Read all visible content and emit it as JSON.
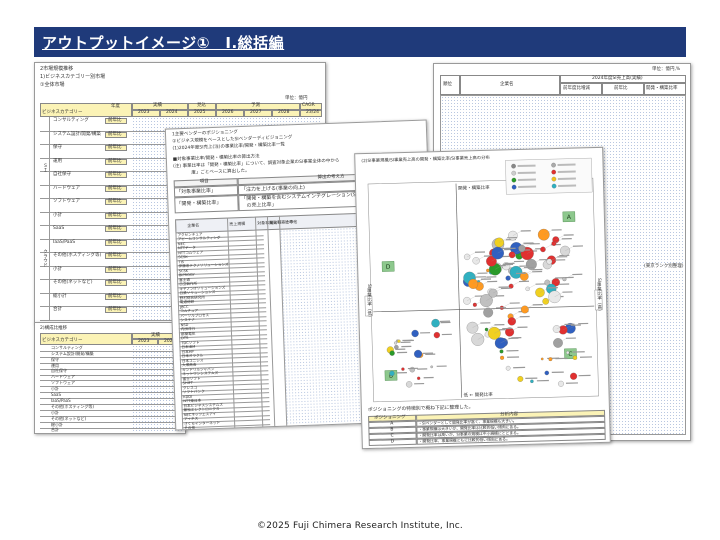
{
  "header": {
    "title": "アウトプットイメージ①　Ⅰ.総括編"
  },
  "sheet1": {
    "lines": [
      "2市場規模推移",
      "1)ビジネスカテゴリー別市場",
      "①全体市場"
    ],
    "unit": "単位：億円",
    "year_label": "年度",
    "category_label": "ビジネスカテゴリー",
    "cols": {
      "actual": "実績",
      "forecast_near": "見込",
      "forecast": "予測",
      "cagr": "CAGR"
    },
    "years": [
      "2023",
      "2024",
      "2025",
      "2026",
      "2027",
      "2028",
      "23/24"
    ],
    "rows": [
      "コンサルティング",
      "システム設計/開発/構築",
      "保守",
      "運用",
      "自社保守",
      "ハードウェア",
      "ソフトウェア",
      "小計",
      "SaaS",
      "IaaS/PaaS",
      "その他(ホスティング等)",
      "小計",
      "その他(ネットなど)",
      "総小計",
      "合計"
    ],
    "yoy": "前年比",
    "side_labels": [
      "ＳＩ",
      "クラウド"
    ],
    "lower_title": "2)構成比推移",
    "lower_actual": "実績",
    "lower_years": [
      "2023",
      "2024"
    ],
    "lower_rows": [
      "コンサルティング",
      "システム設計/開発/構築",
      "保守",
      "運用",
      "自社保守",
      "ハードウェア",
      "ソフトウェア",
      "小計",
      "SaaS",
      "IaaS/PaaS",
      "その他(ホスティング等)",
      "小計",
      "その他(ネットなど)",
      "総小計",
      "合計"
    ]
  },
  "sheet2": {
    "lines": [
      "1主要ベンダーのポジショニング",
      "①ビジネス規模をベースとしたSIベンダーディビジョニング",
      "(1)2024年度SI売上(注)の事業比率/開発・構築比率一覧"
    ],
    "note1": "■対象事業比率/開発・構築比率の算出方法",
    "note2": "(注) 事業比率は「開発・構築比率」について、調査対象企業のSI事業全体の中から",
    "note3": "　　　　度」ごとベースに算出した。",
    "box_head1": "項目",
    "box_head2": "算出の考え方",
    "box_r1c1": "「対象事業比率」",
    "box_r1c2": "「注力を上げる(事業の向上)",
    "box_r2c1": "「開発・構築比率」",
    "box_r2c2": "「開発・構築を含むシステムインテグレーション(SI)設計・開発・構築",
    "box_r2c3": "　の売上比率」",
    "table_headers": [
      "企業名",
      "売上規模",
      "対象事業比率",
      "開発構築比率",
      "その他"
    ],
    "companies": [
      "アクセンチュア",
      "アビームコンサルティング",
      "NEC",
      "NTTデータ",
      "NTTコムウェア",
      "SCSK",
      "TIS",
      "伊藤忠テクノソリューションズ",
      "SCSK",
      "BIPROGY",
      "富士通",
      "日立製作所",
      "キヤノンITソリューションズ",
      "日鉄ソリューションズ",
      "野村総合研究所",
      "電通総研",
      "JBCC",
      "コムチュア",
      "パーソルプロセス",
      "システナ",
      "NSD",
      "内田洋行",
      "都築電気",
      "DTS",
      "TDCソフト",
      "日本IBM",
      "日本HP",
      "日本オラクル",
      "日本ユニシス",
      "大塚商会",
      "キンドリルジャパン",
      "ネットワンシステムズ",
      "富士ソフト",
      "SHIFT",
      "クレスコ",
      "ソフトバンク",
      "KDDI",
      "NTT東日本",
      "日本ビジネスシステムズ",
      "兼松エレクトロニクス",
      "NECネッツエスアイ",
      "アイネス",
      "さくらインターネット",
      "その他"
    ]
  },
  "sheet3": {
    "title_left": "2024年度",
    "title_right": "単位：億円,%",
    "head": [
      "順位",
      "企業名",
      "2024年度SI売上高(実績)"
    ],
    "subhead": [
      "前年度比増減",
      "前年比",
      "開発・構築比率"
    ],
    "side_note": "(東京ランク別整理)"
  },
  "sheet4": {
    "title": "(2)SI事業規模/SI事業売上高の開発・構築比率/SI事業売上高の分布",
    "y_top": "開発・構築比率",
    "x_bottom": "低 ← 開発比率",
    "left_label": "SI事業比率（低）",
    "right_label": "SI事業比率（高）",
    "quadrants": [
      "A",
      "B",
      "C",
      "D"
    ],
    "section_title": "ポジショニングの特徴別で概ね下記に整理した。",
    "table_headers": [
      "ポジショニング",
      "分析内容"
    ],
    "table_rows": [
      {
        "q": "A",
        "text": "・SIベンダーとして開発比率が高く、事業規模も大きい。"
      },
      {
        "q": "B",
        "text": "・事業規模は大きいが、開発比率は比較的低い傾向にある。"
      },
      {
        "q": "C",
        "text": "・開発比率は高いが、SI事業の規模は中小規模にとどまる。"
      },
      {
        "q": "D",
        "text": "・開発比率、事業規模ともに比較的低い傾向にある。"
      }
    ]
  },
  "colors": {
    "header_bg": "#1f3a7a",
    "cell_yellow": "#fbf3b6",
    "grid_dot": "#b9c7e0"
  },
  "footer": {
    "copyright": "©2025 Fuji Chimera Research Institute, Inc."
  }
}
